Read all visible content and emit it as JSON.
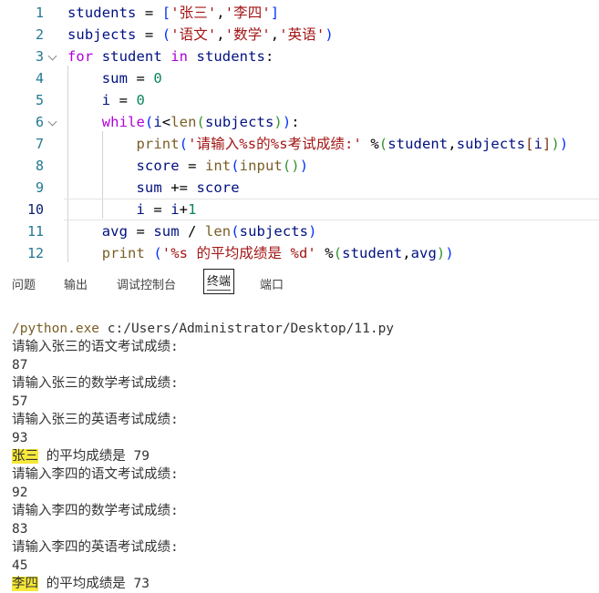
{
  "editor": {
    "lines": [
      {
        "num": "1",
        "tokens": [
          [
            "var",
            "students"
          ],
          [
            "op",
            " = "
          ],
          [
            "pa",
            "["
          ],
          [
            "str",
            "'张三'"
          ],
          [
            "op",
            ","
          ],
          [
            "str",
            "'李四'"
          ],
          [
            "pa",
            "]"
          ]
        ]
      },
      {
        "num": "2",
        "tokens": [
          [
            "var",
            "subjects"
          ],
          [
            "op",
            " = "
          ],
          [
            "pa",
            "("
          ],
          [
            "str",
            "'语文'"
          ],
          [
            "op",
            ","
          ],
          [
            "str",
            "'数学'"
          ],
          [
            "op",
            ","
          ],
          [
            "str",
            "'英语'"
          ],
          [
            "pa",
            ")"
          ]
        ]
      },
      {
        "num": "3",
        "tokens": [
          [
            "kw",
            "for"
          ],
          [
            "op",
            " "
          ],
          [
            "var",
            "student"
          ],
          [
            "op",
            " "
          ],
          [
            "kw",
            "in"
          ],
          [
            "op",
            " "
          ],
          [
            "var",
            "students"
          ],
          [
            "op",
            ":"
          ]
        ]
      },
      {
        "num": "4",
        "tokens": [
          [
            "op",
            "    "
          ],
          [
            "var",
            "sum"
          ],
          [
            "op",
            " = "
          ],
          [
            "num",
            "0"
          ]
        ]
      },
      {
        "num": "5",
        "tokens": [
          [
            "op",
            "    "
          ],
          [
            "var",
            "i"
          ],
          [
            "op",
            " = "
          ],
          [
            "num",
            "0"
          ]
        ]
      },
      {
        "num": "6",
        "tokens": [
          [
            "op",
            "    "
          ],
          [
            "kw",
            "while"
          ],
          [
            "pa",
            "("
          ],
          [
            "var",
            "i"
          ],
          [
            "op",
            "<"
          ],
          [
            "fn",
            "len"
          ],
          [
            "pb",
            "("
          ],
          [
            "var",
            "subjects"
          ],
          [
            "pb",
            ")"
          ],
          [
            "pa",
            ")"
          ],
          [
            "op",
            ":"
          ]
        ]
      },
      {
        "num": "7",
        "tokens": [
          [
            "op",
            "        "
          ],
          [
            "fn",
            "print"
          ],
          [
            "pa",
            "("
          ],
          [
            "str",
            "'请输入%s的%s考试成绩:'"
          ],
          [
            "op",
            " %"
          ],
          [
            "pb",
            "("
          ],
          [
            "var",
            "student"
          ],
          [
            "op",
            ","
          ],
          [
            "var",
            "subjects"
          ],
          [
            "pc",
            "["
          ],
          [
            "var",
            "i"
          ],
          [
            "pc",
            "]"
          ],
          [
            "pb",
            ")"
          ],
          [
            "pa",
            ")"
          ]
        ]
      },
      {
        "num": "8",
        "tokens": [
          [
            "op",
            "        "
          ],
          [
            "var",
            "score"
          ],
          [
            "op",
            " = "
          ],
          [
            "fn",
            "int"
          ],
          [
            "pa",
            "("
          ],
          [
            "fn",
            "input"
          ],
          [
            "pb",
            "()"
          ],
          [
            "pa",
            ")"
          ]
        ]
      },
      {
        "num": "9",
        "tokens": [
          [
            "op",
            "        "
          ],
          [
            "var",
            "sum"
          ],
          [
            "op",
            " += "
          ],
          [
            "var",
            "score"
          ]
        ]
      },
      {
        "num": "10",
        "tokens": [
          [
            "op",
            "        "
          ],
          [
            "var",
            "i"
          ],
          [
            "op",
            " = "
          ],
          [
            "var",
            "i"
          ],
          [
            "op",
            "+"
          ],
          [
            "num",
            "1"
          ]
        ]
      },
      {
        "num": "11",
        "tokens": [
          [
            "op",
            "    "
          ],
          [
            "var",
            "avg"
          ],
          [
            "op",
            " = "
          ],
          [
            "var",
            "sum"
          ],
          [
            "op",
            " / "
          ],
          [
            "fn",
            "len"
          ],
          [
            "pa",
            "("
          ],
          [
            "var",
            "subjects"
          ],
          [
            "pa",
            ")"
          ]
        ]
      },
      {
        "num": "12",
        "tokens": [
          [
            "op",
            "    "
          ],
          [
            "fn",
            "print"
          ],
          [
            "op",
            " "
          ],
          [
            "pa",
            "("
          ],
          [
            "str",
            "'%s 的平均成绩是 %d'"
          ],
          [
            "op",
            " %"
          ],
          [
            "pb",
            "("
          ],
          [
            "var",
            "student"
          ],
          [
            "op",
            ","
          ],
          [
            "var",
            "avg"
          ],
          [
            "pb",
            ")"
          ],
          [
            "pa",
            ")"
          ]
        ]
      }
    ]
  },
  "panel": {
    "tabs": [
      {
        "label": "问题",
        "id": "problems"
      },
      {
        "label": "输出",
        "id": "output"
      },
      {
        "label": "调试控制台",
        "id": "debug-console"
      },
      {
        "label": "终端",
        "id": "terminal"
      },
      {
        "label": "端口",
        "id": "ports"
      }
    ],
    "active_tab": "终端"
  },
  "terminal": {
    "command_exe": "/python.exe",
    "command_arg": " c:/Users/Administrator/Desktop/11.py",
    "lines": [
      {
        "text": "请输入张三的语文考试成绩:"
      },
      {
        "text": "87"
      },
      {
        "text": "请输入张三的数学考试成绩:"
      },
      {
        "text": "57"
      },
      {
        "text": "请输入张三的英语考试成绩:"
      },
      {
        "text": "93"
      },
      {
        "highlight": "张三",
        "rest": " 的平均成绩是 79"
      },
      {
        "text": "请输入李四的语文考试成绩:"
      },
      {
        "text": "92"
      },
      {
        "text": "请输入李四的数学考试成绩:"
      },
      {
        "text": "83"
      },
      {
        "text": "请输入李四的英语考试成绩:"
      },
      {
        "text": "45"
      },
      {
        "highlight": "李四",
        "rest": " 的平均成绩是 73"
      }
    ]
  }
}
